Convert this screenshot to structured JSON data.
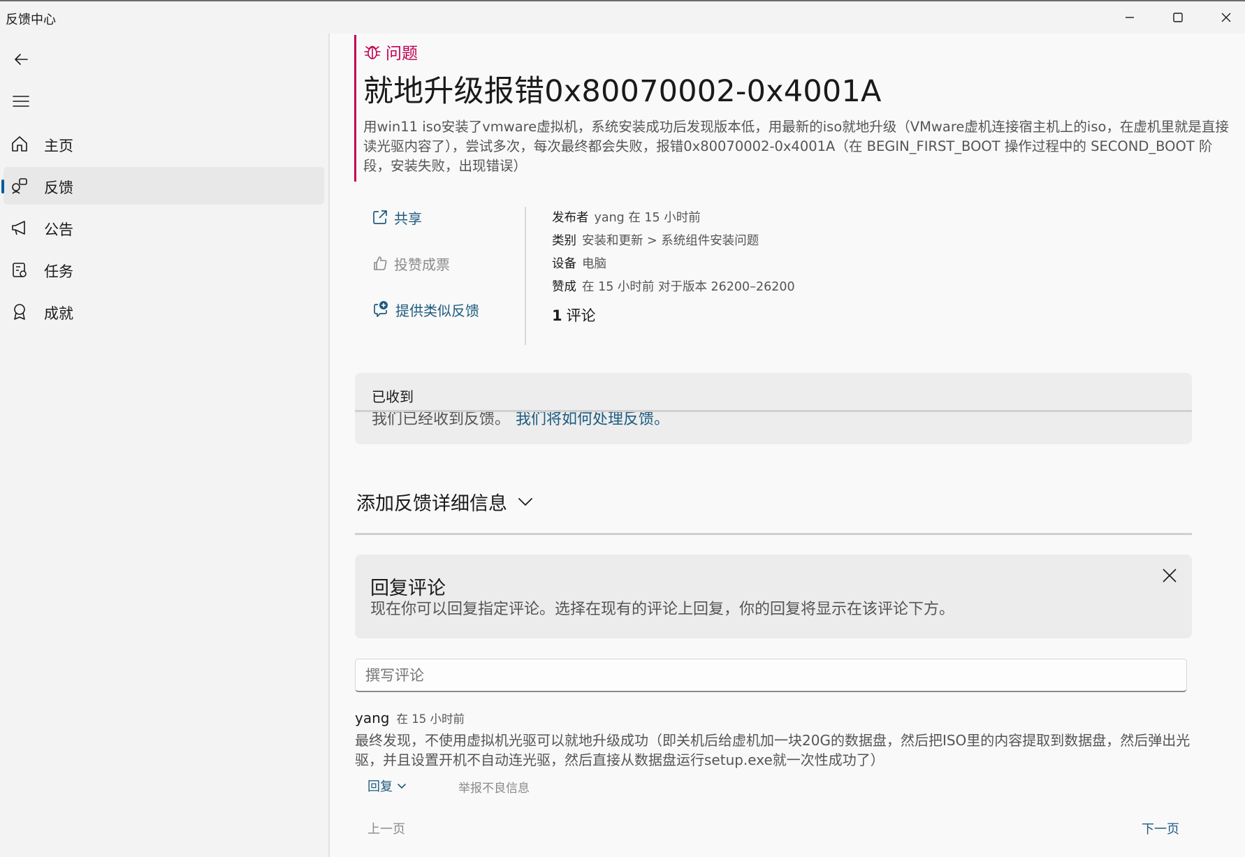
{
  "window": {
    "title": "反馈中心"
  },
  "sidebar": {
    "items": [
      {
        "label": "主页",
        "icon": "home-icon"
      },
      {
        "label": "反馈",
        "icon": "feedback-icon",
        "selected": true
      },
      {
        "label": "公告",
        "icon": "megaphone-icon"
      },
      {
        "label": "任务",
        "icon": "task-icon"
      },
      {
        "label": "成就",
        "icon": "badge-icon"
      }
    ]
  },
  "issue": {
    "type_label": "问题",
    "title": "就地升级报错0x80070002-0x4001A",
    "description": "用win11 iso安装了vmware虚拟机，系统安装成功后发现版本低，用最新的iso就地升级（VMware虚机连接宿主机上的iso，在虚机里就是直接读光驱内容了），尝试多次，每次最终都会失败，报错0x80070002-0x4001A（在 BEGIN_FIRST_BOOT 操作过程中的 SECOND_BOOT 阶段，安装失败，出现错误）"
  },
  "actions": {
    "share": "共享",
    "vote": "投赞成票",
    "similar": "提供类似反馈"
  },
  "meta": {
    "publisher_label": "发布者",
    "publisher_value": "yang 在 15 小时前",
    "category_label": "类别",
    "category_value": "安装和更新 > 系统组件安装问题",
    "device_label": "设备",
    "device_value": "电脑",
    "upvote_label": "赞成",
    "upvote_value": "在 15 小时前 对于版本 26200–26200",
    "comment_count": "1",
    "comment_label": "评论"
  },
  "received": {
    "heading": "已收到",
    "text": "我们已经收到反馈。",
    "link": "我们将如何处理反馈。"
  },
  "details": {
    "label": "添加反馈详细信息"
  },
  "reply_card": {
    "heading": "回复评论",
    "text": "现在你可以回复指定评论。选择在现有的评论上回复，你的回复将显示在该评论下方。"
  },
  "comment_input": {
    "placeholder": "撰写评论"
  },
  "comment": {
    "author": "yang",
    "time": "在 15 小时前",
    "body": "最终发现，不使用虚拟机光驱可以就地升级成功（即关机后给虚机加一块20G的数据盘，然后把ISO里的内容提取到数据盘，然后弹出光驱，并且设置开机不自动连光驱，然后直接从数据盘运行setup.exe就一次性成功了）",
    "reply_label": "回复",
    "report_label": "举报不良信息"
  },
  "pager": {
    "prev": "上一页",
    "next": "下一页"
  },
  "colors": {
    "accent": "#1e5b80",
    "issue": "#c30052",
    "selection_indicator": "#005a9e"
  }
}
